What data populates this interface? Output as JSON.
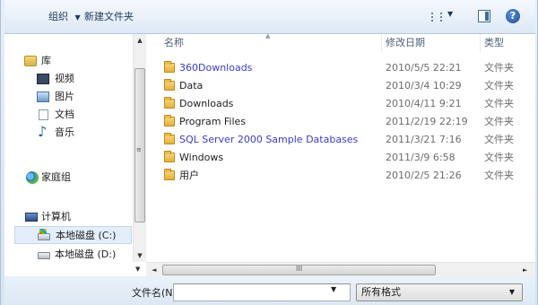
{
  "toolbar": {
    "organize_label": "组织",
    "organize_arrow": "▼",
    "new_folder_label": "新建文件夹",
    "view_arrow": "▼",
    "help_label": "?"
  },
  "nav": {
    "items": [
      {
        "label": "库",
        "icon": "library-icon"
      },
      {
        "label": "视频",
        "icon": "video-icon"
      },
      {
        "label": "图片",
        "icon": "pictures-icon"
      },
      {
        "label": "文档",
        "icon": "documents-icon"
      },
      {
        "label": "音乐",
        "icon": "music-icon"
      },
      {
        "label": "家庭组",
        "icon": "homegroup-icon"
      },
      {
        "label": "计算机",
        "icon": "computer-icon"
      },
      {
        "label": "本地磁盘 (C:)",
        "icon": "drive-c-icon",
        "selected": true
      },
      {
        "label": "本地磁盘 (D:)",
        "icon": "drive-d-icon"
      }
    ]
  },
  "files": {
    "columns": {
      "name": "名称",
      "date": "修改日期",
      "type": "类型"
    },
    "rows": [
      {
        "name": "360Downloads",
        "date": "2010/5/5 22:21",
        "type": "文件夹",
        "link": true
      },
      {
        "name": "Data",
        "date": "2010/3/4 10:29",
        "type": "文件夹",
        "link": false
      },
      {
        "name": "Downloads",
        "date": "2010/4/11 9:21",
        "type": "文件夹",
        "link": false
      },
      {
        "name": "Program Files",
        "date": "2011/2/19 22:19",
        "type": "文件夹",
        "link": false
      },
      {
        "name": "SQL Server 2000 Sample Databases",
        "date": "2011/3/21 7:16",
        "type": "文件夹",
        "link": true
      },
      {
        "name": "Windows",
        "date": "2011/3/9 6:58",
        "type": "文件夹",
        "link": false
      },
      {
        "name": "用户",
        "date": "2010/2/5 21:26",
        "type": "文件夹",
        "link": false
      }
    ]
  },
  "scroll": {
    "nav_up": "▲",
    "nav_down": "▼",
    "grip": "≡",
    "h_left": "◄",
    "h_right": "►",
    "h_grip": "III"
  },
  "bottom": {
    "filename_label": "文件名(N):",
    "filename_value": "",
    "filename_dropdown": "▼",
    "filetype_value": "所有格式",
    "filetype_dropdown": "▼"
  }
}
